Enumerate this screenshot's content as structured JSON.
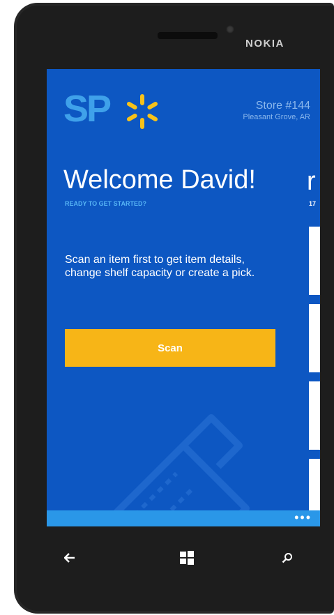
{
  "device": {
    "brand": "NOKIA"
  },
  "app": {
    "logo_text": "SP",
    "store_number": "Store #144",
    "store_location": "Pleasant Grove, AR"
  },
  "main": {
    "welcome_title": "Welcome David!",
    "welcome_subtitle": "READY TO GET STARTED?",
    "description": "Scan an item first to get item details, change shelf capacity or create a pick.",
    "scan_label": "Scan"
  },
  "next_pivot": {
    "title_fragment": "r",
    "subtitle_fragment": "17"
  },
  "app_bar": {
    "more_label": "•••"
  },
  "nav": {
    "back_icon": "back-arrow-icon",
    "start_icon": "windows-icon",
    "search_icon": "search-icon"
  },
  "colors": {
    "screen_bg": "#0d57c2",
    "accent_yellow": "#f7b517",
    "logo_blue": "#3fa1ea",
    "app_bar": "#2a97e8"
  }
}
